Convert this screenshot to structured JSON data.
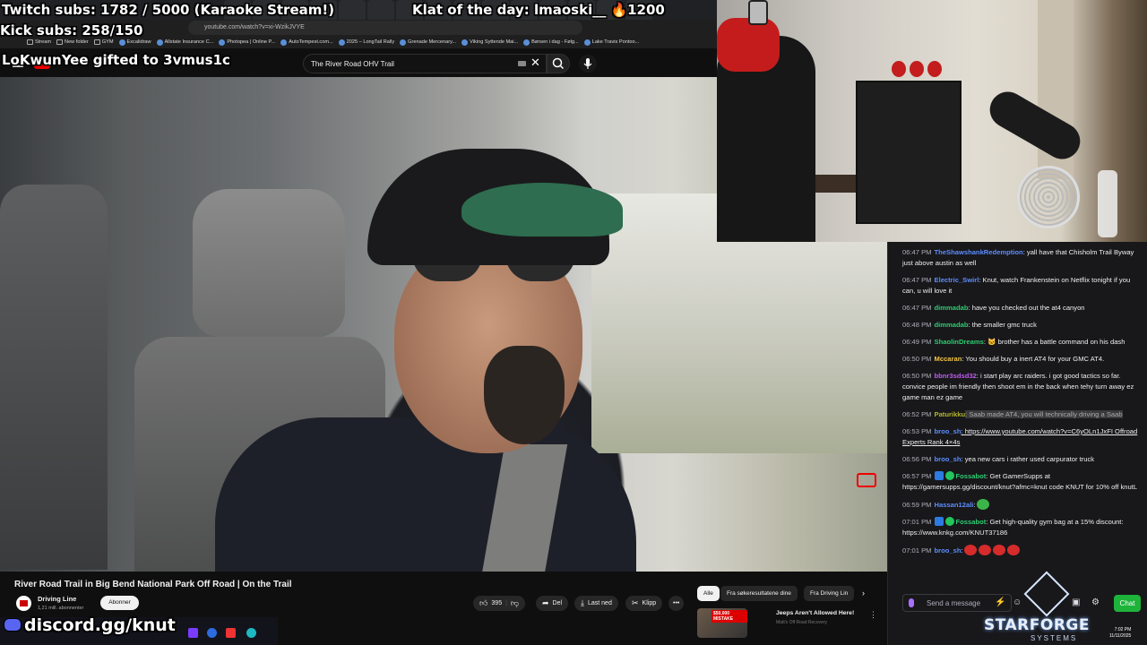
{
  "overlay": {
    "twitch_subs": "Twitch subs: 1782 / 5000 (Karaoke Stream!)",
    "klat_of_day": "Klat of the day: lmaoski__ 🔥1200",
    "kick_subs": "Kick subs: 258/150",
    "gift_notice": "LoKwunYee gifted to 3vmus1c",
    "discord": "discord.gg/knut"
  },
  "browser": {
    "url": "youtube.com/watch?v=xi-WzikJVYE",
    "bookmarks": [
      "Stream",
      "New folder",
      "GYM",
      "Excalidraw",
      "Allstate Insurance C...",
      "Photopea | Online P...",
      "AutoTempest.com...",
      "2025 – LongTail Rally",
      "Grenade Mercenary...",
      "Viking Syttende Mai...",
      "Børsen i dag - Følg...",
      "Lake Travis Pontoo..."
    ]
  },
  "youtube": {
    "search_value": "The River Road OHV Trail",
    "video_title": "River Road Trail in Big Bend National Park Off Road | On the Trail",
    "channel_name": "Driving Line",
    "channel_subs": "1,21 mill. abonnenter",
    "subscribe_label": "Abonner",
    "like_count": "395",
    "share_label": "Del",
    "download_label": "Last ned",
    "clip_label": "Klipp",
    "chips": [
      "Alle",
      "Fra søkeresultatene dine",
      "Fra Driving Lin"
    ],
    "rec_title": "Jeeps Aren't Allowed Here!",
    "rec_channel": "Matt's Off Road Recovery",
    "rec_badge": "$50,000 MISTAKE"
  },
  "chat": {
    "messages": [
      {
        "ts": "06:47 PM",
        "user": "TheShawshankRedemption",
        "color": "#5c8dff",
        "text": ": yall have that Chisholm Trail Byway just above austin as well"
      },
      {
        "ts": "06:47 PM",
        "user": "Electric_Swirl",
        "color": "#5c8dff",
        "text": ": Knut, watch Frankenstein on Netflix tonight if you can, u will love it"
      },
      {
        "ts": "06:47 PM",
        "user": "dimmadab",
        "color": "#2ecc71",
        "text": ": have you checked out the at4 canyon"
      },
      {
        "ts": "06:48 PM",
        "user": "dimmadab",
        "color": "#2ecc71",
        "text": ": the smaller gmc truck"
      },
      {
        "ts": "06:49 PM",
        "user": "ShaolinDreams",
        "color": "#2ecc71",
        "text": ": 🐱 brother has a battle command on his dash"
      },
      {
        "ts": "06:50 PM",
        "user": "Mccaran",
        "color": "#f5c542",
        "text": ": You should buy a inert AT4 for your GMC AT4."
      },
      {
        "ts": "06:50 PM",
        "user": "bbnr3sdsd32",
        "color": "#bf5af2",
        "text": ": i start play arc raiders. i got good tactics so far. convice people im friendly then shoot em in the back when tehy turn away ez game man ez game"
      },
      {
        "ts": "06:52 PM",
        "user": "Paturikku",
        "color": "#b5b52e",
        "text": ": Saab made AT4, you will technically driving a Saab"
      },
      {
        "ts": "06:53 PM",
        "user": "broo_sh",
        "color": "#5c8dff",
        "text": ": https://www.youtube.com/watch?v=C6yOLn1JxFI Offroad Experts Rank 4×4s"
      },
      {
        "ts": "06:56 PM",
        "user": "broo_sh",
        "color": "#5c8dff",
        "text": ": yea new cars i rather used carpurator truck"
      },
      {
        "ts": "06:57 PM",
        "user": "Fossabot",
        "color": "#2ecc71",
        "text": ": Get GamerSupps at https://gamersupps.gg/discount/knut?afmc=knut code KNUT for 10% off knutL"
      },
      {
        "ts": "06:59 PM",
        "user": "Hassan12ali",
        "color": "#5c8dff",
        "text": ":"
      },
      {
        "ts": "07:01 PM",
        "user": "Fossabot",
        "color": "#2ecc71",
        "text": ": Get high-quality gym bag at a 15% discount: https://www.knkg.com/KNUT37186"
      },
      {
        "ts": "07:01 PM",
        "user": "broo_sh",
        "color": "#5c8dff",
        "text": ":"
      }
    ],
    "input_placeholder": "Send a message",
    "chat_button": "Chat"
  },
  "branding": {
    "sponsor": "STARFORGE",
    "sponsor_sub": "SYSTEMS"
  },
  "clock": {
    "time": "7:02 PM",
    "date": "11/11/2025"
  }
}
